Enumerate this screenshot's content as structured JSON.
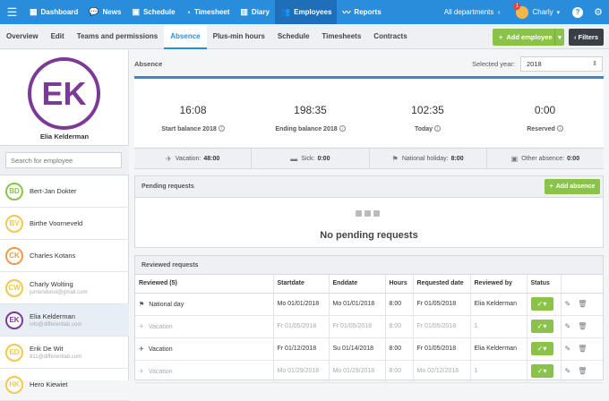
{
  "topnav": {
    "items": [
      {
        "label": "Dashboard",
        "icon": "grid-icon"
      },
      {
        "label": "News",
        "icon": "chat-icon"
      },
      {
        "label": "Schedule",
        "icon": "calendar-icon"
      },
      {
        "label": "Timesheet",
        "icon": "clock-icon"
      },
      {
        "label": "Diary",
        "icon": "book-icon"
      },
      {
        "label": "Employees",
        "icon": "users-icon"
      },
      {
        "label": "Reports",
        "icon": "chart-icon"
      }
    ],
    "department": "All departments",
    "user": "Charly",
    "notifications": "1"
  },
  "subnav": {
    "tabs": [
      "Overview",
      "Edit",
      "Teams and permissions",
      "Absence",
      "Plus-min hours",
      "Schedule",
      "Timesheets",
      "Contracts"
    ],
    "add_employee": "Add employee",
    "filters": "Filters"
  },
  "sidebar": {
    "selected_initials": "EK",
    "selected_name": "Elia Kelderman",
    "search_placeholder": "Search for employee",
    "employees": [
      {
        "initials": "BD",
        "name": "Bert-Jan Dokter",
        "sub": "",
        "color": "#8bc34a"
      },
      {
        "initials": "BV",
        "name": "Birthe Voorneveld",
        "sub": "",
        "color": "#f2c94c"
      },
      {
        "initials": "CK",
        "name": "Charles Kotans",
        "sub": "",
        "color": "#f2994a"
      },
      {
        "initials": "CW",
        "name": "Charly Wolting",
        "sub": "jurriendsnoi@gmail.com",
        "color": "#f2c94c"
      },
      {
        "initials": "EK",
        "name": "Elia Kelderman",
        "sub": "info@differentlab.com",
        "color": "#7b3a96"
      },
      {
        "initials": "ED",
        "name": "Erik De Wit",
        "sub": "811@differentlab.com",
        "color": "#f2c94c"
      },
      {
        "initials": "HK",
        "name": "Hero Kiewiet",
        "sub": "",
        "color": "#f2c94c"
      }
    ]
  },
  "absence": {
    "label": "Absence",
    "year_label": "Selected year:",
    "year": "2018",
    "stats": [
      {
        "value": "16:08",
        "label": "Start balance 2018"
      },
      {
        "value": "198:35",
        "label": "Ending balance 2018"
      },
      {
        "value": "102:35",
        "label": "Today"
      },
      {
        "value": "0:00",
        "label": "Reserved"
      }
    ],
    "types": [
      {
        "icon": "plane-icon",
        "label": "Vacation:",
        "value": "48:00"
      },
      {
        "icon": "medkit-icon",
        "label": "Sick:",
        "value": "0:00"
      },
      {
        "icon": "flag-icon",
        "label": "National holiday:",
        "value": "8:00"
      },
      {
        "icon": "calendar-icon",
        "label": "Other absence:",
        "value": "0:00"
      }
    ]
  },
  "pending": {
    "title": "Pending requests",
    "add_label": "Add absence",
    "empty": "No pending requests"
  },
  "reviewed": {
    "title": "Reviewed requests",
    "columns": [
      "Reviewed (5)",
      "Startdate",
      "Enddate",
      "Hours",
      "Requested date",
      "Reviewed by",
      "Status"
    ],
    "rows": [
      {
        "type": "National day",
        "icon": "flag-icon",
        "start": "Mo 01/01/2018",
        "end": "Mo 01/01/2018",
        "hours": "8:00",
        "requested": "Fr 01/05/2018",
        "by": "Elia Kelderman",
        "faded": false
      },
      {
        "type": "Vacation",
        "icon": "plane-icon",
        "start": "Fr 01/05/2018",
        "end": "Fr 01/05/2018",
        "hours": "8:00",
        "requested": "Fr 01/05/2018",
        "by": "1",
        "faded": true
      },
      {
        "type": "Vacation",
        "icon": "plane-icon",
        "start": "Fr 01/12/2018",
        "end": "Su 01/14/2018",
        "hours": "8:00",
        "requested": "Fr 01/05/2018",
        "by": "Elia Kelderman",
        "faded": false
      },
      {
        "type": "Vacation",
        "icon": "plane-icon",
        "start": "Mo 01/29/2018",
        "end": "Mo 01/29/2018",
        "hours": "8:00",
        "requested": "Mo 02/12/2018",
        "by": "1",
        "faded": true
      }
    ]
  }
}
